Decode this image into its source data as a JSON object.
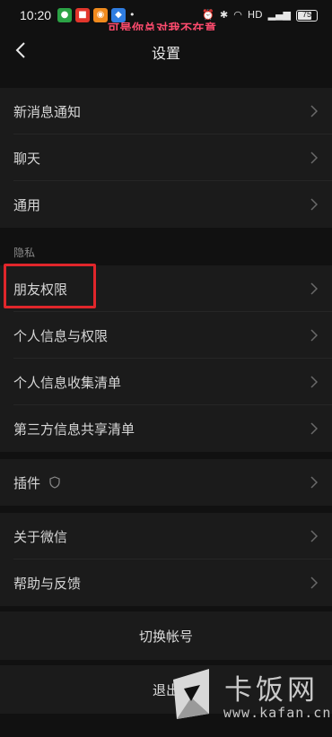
{
  "status_bar": {
    "time": "10:20",
    "overlay_caption": "可是你总对我不在意",
    "network_label": "HD",
    "battery_level": "75",
    "battery_fraction": 0.75
  },
  "header": {
    "title": "设置"
  },
  "menu": {
    "new_message_notify": "新消息通知",
    "chat": "聊天",
    "general": "通用",
    "privacy_section": "隐私",
    "friend_permissions": "朋友权限",
    "personal_info_permissions": "个人信息与权限",
    "personal_info_list": "个人信息收集清单",
    "third_party_list": "第三方信息共享清单",
    "plugins": "插件",
    "about_wechat": "关于微信",
    "help_feedback": "帮助与反馈",
    "switch_account": "切换帐号",
    "logout": "退出"
  },
  "watermark": {
    "brand": "卡饭网",
    "url": "www.kafan.cn"
  },
  "icons": {
    "back": "back-chevron-icon",
    "row_arrow": "chevron-right-icon",
    "plugin_badge": "shield-icon"
  },
  "colors": {
    "background": "#111111",
    "row_background": "#1b1b1b",
    "highlight_box": "#e0262b",
    "caption": "#ff4b6e"
  }
}
